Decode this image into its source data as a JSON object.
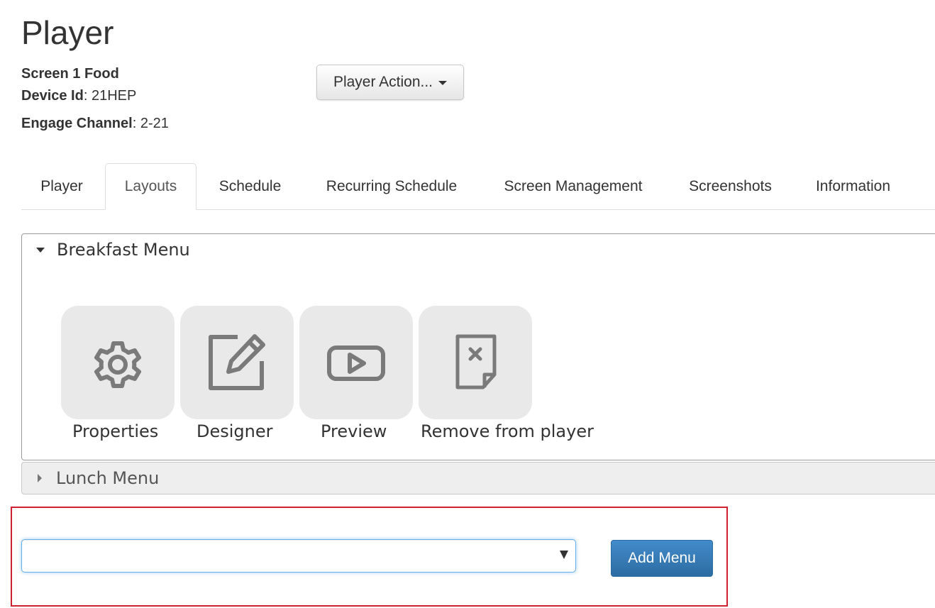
{
  "page": {
    "title": "Player",
    "screen_name": "Screen 1 Food",
    "device_id_label": "Device Id",
    "device_id_value": ": 21HEP",
    "engage_channel_label": "Engage Channel",
    "engage_channel_value": ": 2-21"
  },
  "player_action_button": "Player Action...",
  "tabs": [
    {
      "label": "Player",
      "active": false
    },
    {
      "label": "Layouts",
      "active": true
    },
    {
      "label": "Schedule",
      "active": false
    },
    {
      "label": "Recurring Schedule",
      "active": false
    },
    {
      "label": "Screen Management",
      "active": false
    },
    {
      "label": "Screenshots",
      "active": false
    },
    {
      "label": "Information",
      "active": false
    }
  ],
  "menus": [
    {
      "name": "Breakfast Menu",
      "expanded": true,
      "actions": [
        {
          "label": "Properties",
          "icon": "gear-icon"
        },
        {
          "label": "Designer",
          "icon": "edit-icon"
        },
        {
          "label": "Preview",
          "icon": "play-icon"
        },
        {
          "label": "Remove from player",
          "icon": "remove-file-icon"
        }
      ]
    },
    {
      "name": "Lunch Menu",
      "expanded": false
    }
  ],
  "menu_select": {
    "value": ""
  },
  "add_menu_button": "Add Menu",
  "colors": {
    "primary": "#337ab7",
    "highlight": "#d0212e",
    "tile_bg": "#e9e9e9",
    "icon": "#7a7a7a"
  }
}
